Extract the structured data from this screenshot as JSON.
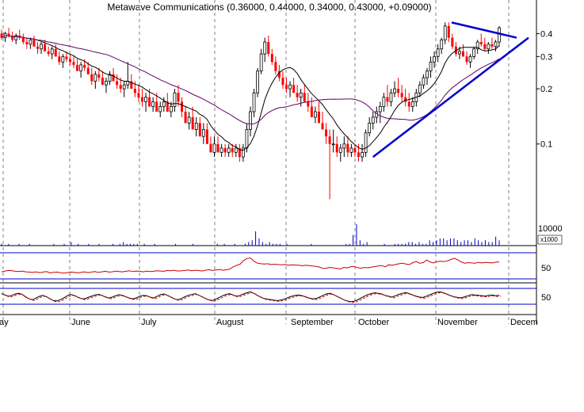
{
  "chart_data": {
    "type": "candlestick",
    "title": "Metawave Communications (0.36000, 0.44000, 0.34000, 0.43000, +0.09000)",
    "colors": {
      "up": "#000000",
      "down": "#ff0000",
      "trendline": "#0000cc",
      "ma": "#000000",
      "ma_long": "#660066",
      "rsi": "#cc0000",
      "volume": "#0000cc",
      "gridline": "#808080",
      "panel_border": "#000000",
      "ref_line": "#0000cc"
    },
    "price_panel": {
      "scale": "log",
      "ylim": [
        0.045,
        0.5
      ],
      "y_ticks": [
        {
          "value": 0.4,
          "label": "0.4"
        },
        {
          "value": 0.3,
          "label": "0.3"
        },
        {
          "value": 0.2,
          "label": "0.2"
        },
        {
          "value": 0.1,
          "label": "0.1"
        }
      ]
    },
    "volume_panel": {
      "label": "10000",
      "unit": "x1000",
      "values": [
        1,
        0,
        1,
        0,
        0,
        1,
        0,
        0,
        1,
        0,
        0,
        0,
        0,
        0,
        0,
        1,
        0,
        0,
        1,
        0,
        2,
        0,
        1,
        0,
        0,
        1,
        0,
        0,
        1,
        0,
        0,
        0,
        1,
        0,
        1,
        2,
        1,
        1,
        1,
        1,
        0,
        1,
        0,
        0,
        1,
        0,
        0,
        0,
        0,
        0,
        1,
        0,
        0,
        0,
        0,
        1,
        0,
        0,
        0,
        0,
        0,
        0,
        1,
        0,
        1,
        0,
        0,
        1,
        0,
        0,
        1,
        2,
        3,
        8,
        4,
        2,
        1,
        2,
        1,
        1,
        1,
        0,
        1,
        0,
        0,
        0,
        0,
        0,
        0,
        1,
        0,
        0,
        0,
        0,
        0,
        0,
        0,
        0,
        0,
        1,
        1,
        6,
        12,
        3,
        1,
        2,
        0,
        0,
        0,
        0,
        1,
        0,
        0,
        1,
        1,
        1,
        1,
        2,
        2,
        1,
        2,
        1,
        1,
        3,
        2,
        3,
        4,
        4,
        3,
        4,
        4,
        3,
        2,
        3,
        3,
        2,
        4,
        3,
        2,
        3,
        2,
        2,
        5,
        3
      ]
    },
    "rsi_panel": {
      "label": "50",
      "values": [
        27,
        30,
        32,
        31,
        29,
        28,
        30,
        27,
        26,
        25,
        27,
        24,
        26,
        28,
        23,
        25,
        26,
        24,
        22,
        24,
        26,
        25,
        23,
        25,
        27,
        24,
        26,
        28,
        25,
        27,
        29,
        26,
        27,
        30,
        28,
        27,
        29,
        31,
        28,
        30,
        29,
        27,
        30,
        28,
        29,
        31,
        30,
        29,
        32,
        31,
        33,
        30,
        31,
        32,
        34,
        31,
        33,
        32,
        30,
        33,
        35,
        32,
        34,
        36,
        33,
        35,
        37,
        46,
        52,
        56,
        70,
        78,
        80,
        68,
        60,
        58,
        57,
        58,
        55,
        56,
        55,
        54,
        55,
        52,
        54,
        53,
        52,
        50,
        52,
        51,
        49,
        48,
        45,
        40,
        41,
        44,
        42,
        40,
        38,
        44,
        42,
        46,
        48,
        43,
        41,
        44,
        42,
        45,
        47,
        49,
        51,
        46,
        54,
        52,
        55,
        58,
        60,
        57,
        55,
        62,
        66,
        60,
        62,
        72,
        65,
        61,
        66,
        68,
        66,
        69,
        74,
        79,
        73,
        65,
        60,
        62,
        61,
        60,
        63,
        61,
        63,
        62,
        61,
        64,
        65
      ]
    },
    "stoch_panel": {
      "label": "50",
      "values": [
        70,
        62,
        55,
        60,
        68,
        72,
        65,
        50,
        40,
        35,
        45,
        55,
        60,
        52,
        40,
        30,
        28,
        35,
        45,
        58,
        65,
        60,
        50,
        42,
        40,
        48,
        55,
        62,
        66,
        60,
        52,
        45,
        50,
        58,
        64,
        60,
        52,
        44,
        40,
        46,
        55,
        60,
        58,
        50,
        45,
        55,
        64,
        68,
        60,
        50,
        40,
        35,
        42,
        52,
        60,
        65,
        70,
        62,
        52,
        42,
        35,
        30,
        38,
        48,
        58,
        66,
        70,
        62,
        55,
        60,
        68,
        75,
        80,
        72,
        60,
        50,
        42,
        38,
        35,
        32,
        30,
        34,
        40,
        48,
        55,
        60,
        62,
        58,
        52,
        45,
        40,
        42,
        50,
        60,
        68,
        72,
        65,
        55,
        45,
        35,
        28,
        24,
        26,
        34,
        45,
        55,
        65,
        70,
        75,
        72,
        68,
        60,
        55,
        50,
        58,
        66,
        72,
        76,
        70,
        62,
        55,
        50,
        48,
        56,
        64,
        72,
        78,
        80,
        74,
        66,
        58,
        52,
        48,
        46,
        52,
        58,
        64,
        62,
        60,
        58,
        56,
        60,
        62,
        58,
        60
      ]
    },
    "months": [
      "ay",
      "June",
      "July",
      "August",
      "September",
      "October",
      "November",
      "Decem"
    ],
    "volume_unit_label": "x1000",
    "rsi_label": "50",
    "stoch_label": "50",
    "series_candles": [
      [
        0.4,
        0.42,
        0.37,
        0.38
      ],
      [
        0.38,
        0.41,
        0.36,
        0.4
      ],
      [
        0.4,
        0.43,
        0.38,
        0.39
      ],
      [
        0.39,
        0.41,
        0.36,
        0.37
      ],
      [
        0.37,
        0.4,
        0.35,
        0.39
      ],
      [
        0.39,
        0.42,
        0.37,
        0.38
      ],
      [
        0.38,
        0.4,
        0.35,
        0.36
      ],
      [
        0.36,
        0.38,
        0.33,
        0.35
      ],
      [
        0.35,
        0.38,
        0.33,
        0.37
      ],
      [
        0.37,
        0.39,
        0.34,
        0.34
      ],
      [
        0.34,
        0.36,
        0.31,
        0.33
      ],
      [
        0.33,
        0.36,
        0.31,
        0.35
      ],
      [
        0.35,
        0.37,
        0.32,
        0.32
      ],
      [
        0.32,
        0.34,
        0.3,
        0.31
      ],
      [
        0.31,
        0.34,
        0.29,
        0.33
      ],
      [
        0.33,
        0.35,
        0.3,
        0.3
      ],
      [
        0.3,
        0.32,
        0.27,
        0.28
      ],
      [
        0.28,
        0.31,
        0.26,
        0.3
      ],
      [
        0.3,
        0.32,
        0.28,
        0.29
      ],
      [
        0.29,
        0.31,
        0.27,
        0.28
      ],
      [
        0.28,
        0.3,
        0.26,
        0.27
      ],
      [
        0.27,
        0.29,
        0.25,
        0.25
      ],
      [
        0.25,
        0.28,
        0.23,
        0.27
      ],
      [
        0.27,
        0.29,
        0.25,
        0.26
      ],
      [
        0.26,
        0.28,
        0.24,
        0.24
      ],
      [
        0.24,
        0.26,
        0.21,
        0.22
      ],
      [
        0.22,
        0.25,
        0.2,
        0.24
      ],
      [
        0.24,
        0.26,
        0.22,
        0.23
      ],
      [
        0.23,
        0.25,
        0.21,
        0.21
      ],
      [
        0.21,
        0.23,
        0.19,
        0.22
      ],
      [
        0.22,
        0.25,
        0.21,
        0.24
      ],
      [
        0.24,
        0.26,
        0.22,
        0.22
      ],
      [
        0.22,
        0.24,
        0.2,
        0.21
      ],
      [
        0.21,
        0.23,
        0.19,
        0.2
      ],
      [
        0.2,
        0.22,
        0.18,
        0.21
      ],
      [
        0.21,
        0.28,
        0.2,
        0.22
      ],
      [
        0.22,
        0.24,
        0.2,
        0.2
      ],
      [
        0.2,
        0.22,
        0.18,
        0.19
      ],
      [
        0.19,
        0.21,
        0.17,
        0.18
      ],
      [
        0.18,
        0.2,
        0.16,
        0.17
      ],
      [
        0.17,
        0.19,
        0.15,
        0.18
      ],
      [
        0.18,
        0.2,
        0.16,
        0.16
      ],
      [
        0.16,
        0.18,
        0.15,
        0.17
      ],
      [
        0.17,
        0.19,
        0.15,
        0.15
      ],
      [
        0.15,
        0.17,
        0.14,
        0.16
      ],
      [
        0.16,
        0.18,
        0.15,
        0.17
      ],
      [
        0.17,
        0.19,
        0.15,
        0.15
      ],
      [
        0.15,
        0.17,
        0.14,
        0.16
      ],
      [
        0.16,
        0.2,
        0.15,
        0.19
      ],
      [
        0.19,
        0.21,
        0.16,
        0.17
      ],
      [
        0.17,
        0.18,
        0.14,
        0.15
      ],
      [
        0.15,
        0.16,
        0.13,
        0.13
      ],
      [
        0.13,
        0.15,
        0.12,
        0.14
      ],
      [
        0.14,
        0.16,
        0.12,
        0.12
      ],
      [
        0.12,
        0.14,
        0.11,
        0.13
      ],
      [
        0.13,
        0.14,
        0.11,
        0.11
      ],
      [
        0.11,
        0.13,
        0.1,
        0.12
      ],
      [
        0.12,
        0.13,
        0.1,
        0.1
      ],
      [
        0.1,
        0.11,
        0.09,
        0.09
      ],
      [
        0.09,
        0.11,
        0.085,
        0.1
      ],
      [
        0.1,
        0.11,
        0.09,
        0.09
      ],
      [
        0.09,
        0.1,
        0.085,
        0.095
      ],
      [
        0.095,
        0.1,
        0.085,
        0.09
      ],
      [
        0.09,
        0.1,
        0.085,
        0.095
      ],
      [
        0.095,
        0.1,
        0.085,
        0.09
      ],
      [
        0.09,
        0.1,
        0.085,
        0.095
      ],
      [
        0.095,
        0.1,
        0.08,
        0.085
      ],
      [
        0.085,
        0.1,
        0.08,
        0.095
      ],
      [
        0.095,
        0.13,
        0.09,
        0.12
      ],
      [
        0.12,
        0.16,
        0.11,
        0.15
      ],
      [
        0.15,
        0.2,
        0.14,
        0.19
      ],
      [
        0.19,
        0.26,
        0.18,
        0.25
      ],
      [
        0.25,
        0.33,
        0.24,
        0.31
      ],
      [
        0.31,
        0.38,
        0.28,
        0.36
      ],
      [
        0.36,
        0.39,
        0.3,
        0.31
      ],
      [
        0.31,
        0.33,
        0.27,
        0.28
      ],
      [
        0.28,
        0.3,
        0.24,
        0.25
      ],
      [
        0.25,
        0.27,
        0.22,
        0.23
      ],
      [
        0.23,
        0.25,
        0.2,
        0.21
      ],
      [
        0.21,
        0.23,
        0.19,
        0.2
      ],
      [
        0.2,
        0.22,
        0.18,
        0.21
      ],
      [
        0.21,
        0.23,
        0.19,
        0.19
      ],
      [
        0.19,
        0.21,
        0.17,
        0.18
      ],
      [
        0.18,
        0.2,
        0.16,
        0.19
      ],
      [
        0.19,
        0.21,
        0.17,
        0.17
      ],
      [
        0.17,
        0.19,
        0.15,
        0.16
      ],
      [
        0.16,
        0.18,
        0.14,
        0.14
      ],
      [
        0.14,
        0.16,
        0.13,
        0.15
      ],
      [
        0.15,
        0.17,
        0.13,
        0.13
      ],
      [
        0.13,
        0.15,
        0.12,
        0.12
      ],
      [
        0.12,
        0.13,
        0.1,
        0.11
      ],
      [
        0.11,
        0.12,
        0.05,
        0.1
      ],
      [
        0.1,
        0.12,
        0.09,
        0.1
      ],
      [
        0.1,
        0.11,
        0.085,
        0.09
      ],
      [
        0.09,
        0.1,
        0.08,
        0.095
      ],
      [
        0.095,
        0.11,
        0.085,
        0.1
      ],
      [
        0.1,
        0.11,
        0.085,
        0.09
      ],
      [
        0.09,
        0.1,
        0.085,
        0.095
      ],
      [
        0.095,
        0.1,
        0.085,
        0.09
      ],
      [
        0.09,
        0.1,
        0.08,
        0.085
      ],
      [
        0.085,
        0.1,
        0.08,
        0.09
      ],
      [
        0.09,
        0.12,
        0.085,
        0.115
      ],
      [
        0.115,
        0.14,
        0.11,
        0.13
      ],
      [
        0.13,
        0.15,
        0.12,
        0.14
      ],
      [
        0.14,
        0.16,
        0.13,
        0.15
      ],
      [
        0.15,
        0.17,
        0.13,
        0.16
      ],
      [
        0.16,
        0.19,
        0.15,
        0.18
      ],
      [
        0.18,
        0.21,
        0.16,
        0.17
      ],
      [
        0.17,
        0.2,
        0.16,
        0.19
      ],
      [
        0.19,
        0.22,
        0.18,
        0.2
      ],
      [
        0.2,
        0.23,
        0.18,
        0.19
      ],
      [
        0.19,
        0.21,
        0.17,
        0.18
      ],
      [
        0.18,
        0.2,
        0.16,
        0.17
      ],
      [
        0.17,
        0.19,
        0.15,
        0.16
      ],
      [
        0.16,
        0.18,
        0.15,
        0.17
      ],
      [
        0.17,
        0.2,
        0.16,
        0.19
      ],
      [
        0.19,
        0.22,
        0.18,
        0.21
      ],
      [
        0.21,
        0.24,
        0.2,
        0.23
      ],
      [
        0.23,
        0.26,
        0.21,
        0.25
      ],
      [
        0.25,
        0.3,
        0.23,
        0.28
      ],
      [
        0.28,
        0.32,
        0.26,
        0.3
      ],
      [
        0.3,
        0.35,
        0.28,
        0.33
      ],
      [
        0.33,
        0.38,
        0.31,
        0.37
      ],
      [
        0.37,
        0.46,
        0.35,
        0.44
      ],
      [
        0.44,
        0.46,
        0.36,
        0.38
      ],
      [
        0.38,
        0.4,
        0.33,
        0.34
      ],
      [
        0.34,
        0.36,
        0.3,
        0.31
      ],
      [
        0.31,
        0.34,
        0.29,
        0.32
      ],
      [
        0.32,
        0.35,
        0.3,
        0.3
      ],
      [
        0.3,
        0.32,
        0.27,
        0.28
      ],
      [
        0.28,
        0.31,
        0.26,
        0.3
      ],
      [
        0.3,
        0.34,
        0.29,
        0.33
      ],
      [
        0.33,
        0.37,
        0.31,
        0.36
      ],
      [
        0.36,
        0.4,
        0.34,
        0.35
      ],
      [
        0.35,
        0.38,
        0.32,
        0.33
      ],
      [
        0.33,
        0.36,
        0.31,
        0.35
      ],
      [
        0.35,
        0.38,
        0.33,
        0.34
      ],
      [
        0.34,
        0.37,
        0.32,
        0.36
      ],
      [
        0.36,
        0.44,
        0.34,
        0.43
      ]
    ]
  }
}
